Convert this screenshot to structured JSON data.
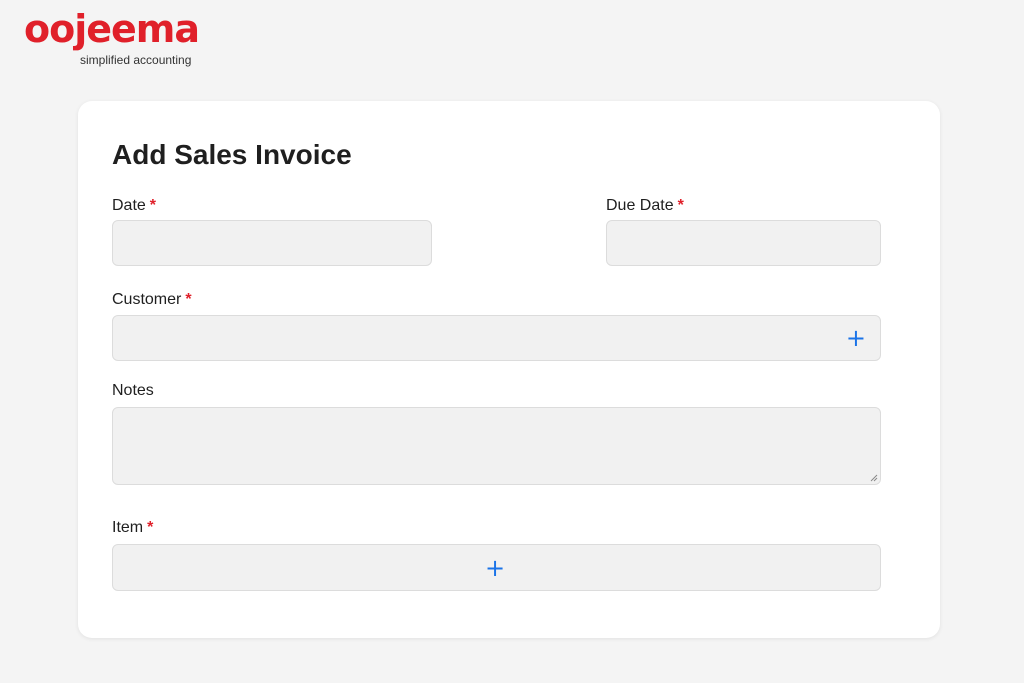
{
  "brand": {
    "name": "oojeema",
    "tagline": "simplified accounting",
    "color": "#e0202a"
  },
  "form": {
    "title": "Add Sales Invoice",
    "required_marker": "*",
    "date_label": "Date",
    "due_date_label": "Due Date",
    "customer_label": "Customer",
    "notes_label": "Notes",
    "item_label": "Item",
    "add_icon": "plus-icon",
    "accent_color": "#1a73e8"
  }
}
